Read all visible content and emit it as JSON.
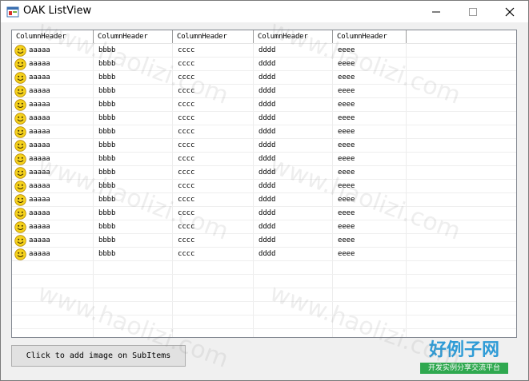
{
  "window": {
    "title": "OAK ListView",
    "icon": "app-window-icon"
  },
  "listview": {
    "columns": [
      "ColumnHeader",
      "ColumnHeader",
      "ColumnHeader",
      "ColumnHeader",
      "ColumnHeader"
    ],
    "row_icon": "smiley-icon",
    "rows": [
      [
        "aaaaa",
        "bbbb",
        "cccc",
        "dddd",
        "eeee"
      ],
      [
        "aaaaa",
        "bbbb",
        "cccc",
        "dddd",
        "eeee"
      ],
      [
        "aaaaa",
        "bbbb",
        "cccc",
        "dddd",
        "eeee"
      ],
      [
        "aaaaa",
        "bbbb",
        "cccc",
        "dddd",
        "eeee"
      ],
      [
        "aaaaa",
        "bbbb",
        "cccc",
        "dddd",
        "eeee"
      ],
      [
        "aaaaa",
        "bbbb",
        "cccc",
        "dddd",
        "eeee"
      ],
      [
        "aaaaa",
        "bbbb",
        "cccc",
        "dddd",
        "eeee"
      ],
      [
        "aaaaa",
        "bbbb",
        "cccc",
        "dddd",
        "eeee"
      ],
      [
        "aaaaa",
        "bbbb",
        "cccc",
        "dddd",
        "eeee"
      ],
      [
        "aaaaa",
        "bbbb",
        "cccc",
        "dddd",
        "eeee"
      ],
      [
        "aaaaa",
        "bbbb",
        "cccc",
        "dddd",
        "eeee"
      ],
      [
        "aaaaa",
        "bbbb",
        "cccc",
        "dddd",
        "eeee"
      ],
      [
        "aaaaa",
        "bbbb",
        "cccc",
        "dddd",
        "eeee"
      ],
      [
        "aaaaa",
        "bbbb",
        "cccc",
        "dddd",
        "eeee"
      ],
      [
        "aaaaa",
        "bbbb",
        "cccc",
        "dddd",
        "eeee"
      ],
      [
        "aaaaa",
        "bbbb",
        "cccc",
        "dddd",
        "eeee"
      ]
    ]
  },
  "button": {
    "label": "Click to add image on SubItems"
  },
  "watermark": {
    "text": "www.haolizi.com",
    "logo_big": "好例子网",
    "logo_small": "开发实例分享交流平台"
  },
  "colors": {
    "window_bg": "#f0f0f0",
    "listview_border": "#828790",
    "logo_blue": "#2e9bd6",
    "logo_green": "#2fa84f",
    "smiley_yellow": "#f5d21c"
  }
}
